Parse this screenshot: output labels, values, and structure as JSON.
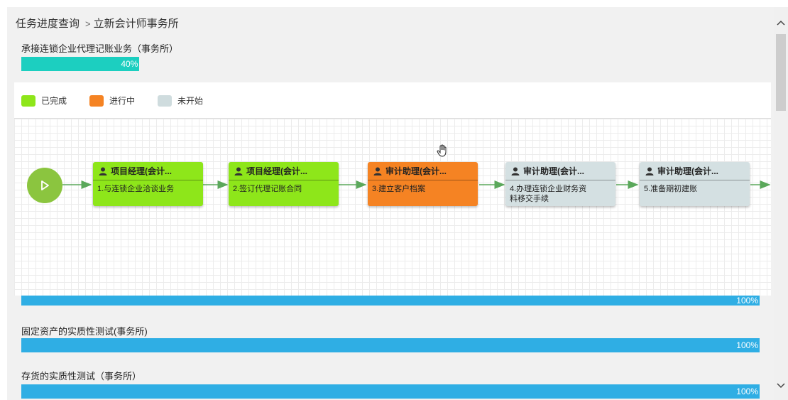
{
  "breadcrumb": {
    "root": "任务进度查询",
    "separator": ">",
    "current": "立新会计师事务所"
  },
  "tasks": [
    {
      "title": "承接连锁企业代理记账业务（事务所）",
      "progress_label": "40%",
      "progress": 0.4,
      "color": "#1ccfc0"
    },
    {
      "title": "",
      "progress_label": "100%",
      "progress": 1.0,
      "color": "#2faee4"
    },
    {
      "title": "固定资产的实质性测试(事务所)",
      "progress_label": "100%",
      "progress": 1.0,
      "color": "#2faee4"
    },
    {
      "title": "存货的实质性测试（事务所）",
      "progress_label": "100%",
      "progress": 1.0,
      "color": "#2faee4"
    }
  ],
  "legend": [
    {
      "label": "已完成",
      "color": "#8ee61a"
    },
    {
      "label": "进行中",
      "color": "#f58323"
    },
    {
      "label": "未开始",
      "color": "#cfdcde"
    }
  ],
  "flow": {
    "start_icon": "play-icon",
    "nodes": [
      {
        "role": "项目经理(会计...",
        "desc": "1.与连锁企业洽谈业务",
        "status": "done"
      },
      {
        "role": "项目经理(会计...",
        "desc": "2.签订代理记账合同",
        "status": "done"
      },
      {
        "role": "审计助理(会计...",
        "desc": "3.建立客户档案",
        "status": "doing"
      },
      {
        "role": "审计助理(会计...",
        "desc": "4.办理连锁企业财务资料移交手续",
        "status": "todo"
      },
      {
        "role": "审计助理(会计...",
        "desc": "5.准备期初建账",
        "status": "todo"
      }
    ]
  },
  "icons": {
    "user": "user-icon",
    "hand": "hand-cursor-icon",
    "scroll_up": "chevron-up-icon",
    "scroll_down": "chevron-down-icon"
  }
}
